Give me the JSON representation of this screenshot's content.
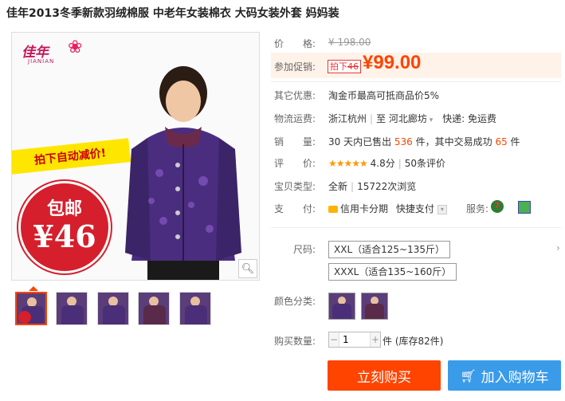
{
  "title": "佳年2013冬季新款羽绒棉服 中老年女装棉衣 大码女装外套 妈妈装",
  "gallery": {
    "logo_text": "佳年",
    "logo_sub": "JIANIAN",
    "banner": "拍下自动减价!",
    "seal_top": "包邮",
    "seal_price": "¥46",
    "zoom_icon": "magnifier-icon",
    "thumb_count": 5
  },
  "price": {
    "label": "价　　格:",
    "original": "¥ 198.00"
  },
  "promo": {
    "label": "参加促销:",
    "tag_prefix": "拍下",
    "tag_amount": "46",
    "price": "¥99.00"
  },
  "other_discount": {
    "label": "其它优惠:",
    "value": "淘金币最高可抵商品价5%"
  },
  "shipping": {
    "label": "物流运费:",
    "from": "浙江杭州",
    "to_prefix": "至",
    "to": "河北廊坊",
    "express": "快递: 免运费"
  },
  "sales": {
    "label": "销　　量:",
    "p1": "30 天内已售出 ",
    "sold": "536",
    "p2": " 件，其中交易成功 ",
    "success": "65",
    "p3": " 件"
  },
  "rating": {
    "label": "评　　价:",
    "stars": "★★★★★",
    "score": "4.8分",
    "reviews": "50条评价"
  },
  "item_type": {
    "label": "宝贝类型:",
    "value": "全新",
    "views": "15722次浏览"
  },
  "payment": {
    "label": "支　　付:",
    "credit": "信用卡分期",
    "quick": "快捷支付",
    "service_label": "服务:",
    "service_7": "7"
  },
  "size": {
    "label": "尺码:",
    "options": [
      "XXL（适合125~135斤）",
      "XXXL（适合135~160斤）"
    ]
  },
  "color": {
    "label": "颜色分类:",
    "swatch_count": 2
  },
  "quantity": {
    "label": "购买数量:",
    "value": "1",
    "stock": "件 (库存82件)"
  },
  "actions": {
    "buy_now": "立刻购买",
    "add_cart": "加入购物车"
  },
  "colors": {
    "accent": "#ff4400",
    "cart_blue": "#3a9be8"
  }
}
